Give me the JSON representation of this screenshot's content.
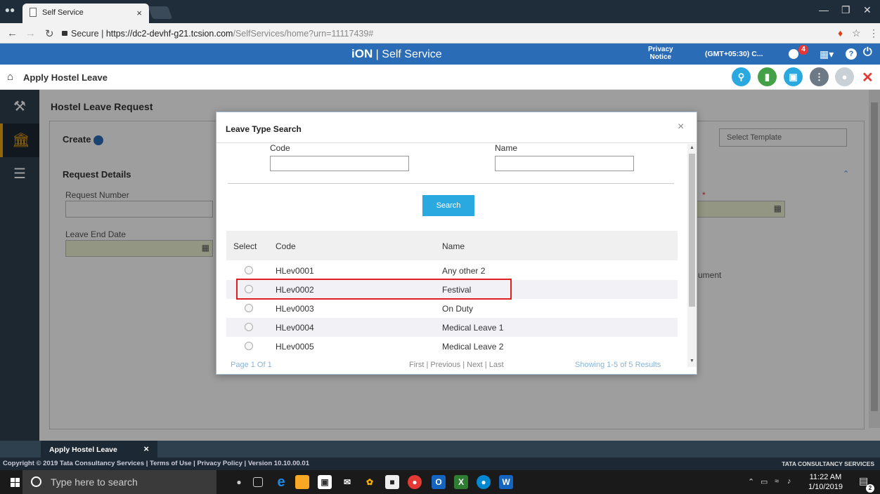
{
  "browser": {
    "tab_title": "Self Service",
    "tab_close": "×",
    "url_secure": "Secure",
    "url_host": "https://dc2-devhf-g21.tcsion.com",
    "url_path": "/SelfServices/home?urn=11117439#"
  },
  "ion_header": {
    "brand": "iON",
    "title": "Self Service",
    "privacy_line1": "Privacy",
    "privacy_line2": "Notice",
    "timezone": "(GMT+05:30) C...",
    "notification_count": "4"
  },
  "page": {
    "title": "Apply Hostel Leave"
  },
  "form": {
    "card_title": "Hostel Leave Request",
    "create_label": "Create",
    "template_placeholder": "Select Template",
    "section_title": "Request Details",
    "request_number_label": "Request Number",
    "leave_end_date_label": "Leave End Date",
    "required_star": "*",
    "hidden_text_fragment": "ument"
  },
  "modal": {
    "title": "Leave Type Search",
    "close": "×",
    "code_label": "Code",
    "name_label": "Name",
    "search_button": "Search",
    "columns": [
      "Select",
      "Code",
      "Name"
    ],
    "rows": [
      {
        "code": "HLev0001",
        "name": "Any other 2"
      },
      {
        "code": "HLev0002",
        "name": "Festival"
      },
      {
        "code": "HLev0003",
        "name": "On Duty"
      },
      {
        "code": "HLev0004",
        "name": "Medical Leave 1"
      },
      {
        "code": "HLev0005",
        "name": "Medical Leave 2"
      }
    ],
    "page_info": "Page 1 Of 1",
    "pager_links": "First | Previous | Next | Last",
    "results_info": "Showing 1-5 of 5 Results"
  },
  "bottom": {
    "tab_label": "Apply Hostel Leave",
    "tab_close": "×",
    "copyright": "Copyright © 2019 Tata Consultancy Services | Terms of Use | Privacy Policy | Version 10.10.00.01",
    "company": "TATA CONSULTANCY SERVICES"
  },
  "taskbar": {
    "search_placeholder": "Type here to search",
    "time": "11:22 AM",
    "date": "1/10/2019",
    "notification_count": "2"
  },
  "colors": {
    "ion_blue": "#2a6cb5",
    "nav_dark": "#2e3f4e",
    "accent_orange": "#f0a30a",
    "search_button": "#29a9e0",
    "highlight_red": "#e02020"
  }
}
